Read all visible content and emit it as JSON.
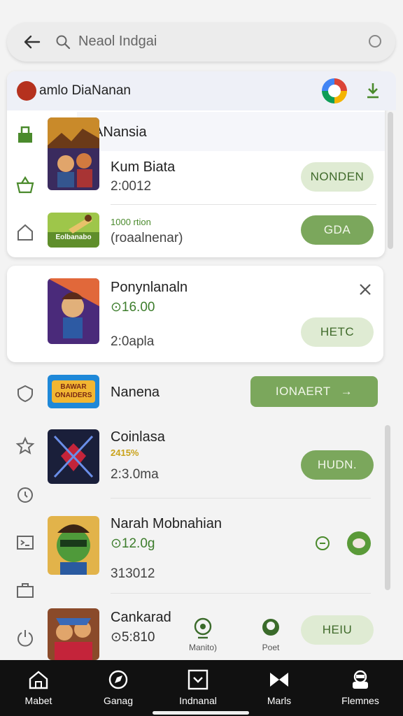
{
  "search": {
    "placeholder": "Neaol Indgai"
  },
  "header": {
    "brand": "amlo DiaNanan"
  },
  "featured": [
    {
      "title": "Kum Biata",
      "meta": "2:0012",
      "button": "NONDEN"
    },
    {
      "title": "1000 rtion",
      "meta": "(roaalnenar)",
      "button": "GDA",
      "thumb_caption": "Eolbanabo"
    }
  ],
  "overlay_title": "ANansia",
  "apps": [
    {
      "title": "Ponynlanaln",
      "price": "16.00",
      "meta": "2:0apla",
      "button": "HETC"
    },
    {
      "title": "Nanena",
      "button": "IONAERT",
      "thumb_caption": "BAWAR ONAIDERS"
    },
    {
      "title": "Coinlasa",
      "price": "2415%",
      "meta": "2:3.0ma",
      "button": "HUDN."
    },
    {
      "title": "Narah Mobnahian",
      "price": "12.0g",
      "meta": "313012"
    },
    {
      "title": "Cankarad",
      "price": "5:810",
      "button": "HEIU"
    }
  ],
  "mini_items": [
    {
      "label": "Manito)"
    },
    {
      "label": "Poet"
    }
  ],
  "bottom_nav": [
    {
      "label": "Mabet",
      "icon": "home-icon"
    },
    {
      "label": "Ganag",
      "icon": "compass-icon"
    },
    {
      "label": "Indnanal",
      "icon": "download-box-icon"
    },
    {
      "label": "Marls",
      "icon": "bowtie-icon"
    },
    {
      "label": "Flemnes",
      "icon": "profile-icon"
    }
  ],
  "colors": {
    "accent": "#7ba75c",
    "accent_light": "#dfebd3",
    "nav_bg": "#111111"
  }
}
